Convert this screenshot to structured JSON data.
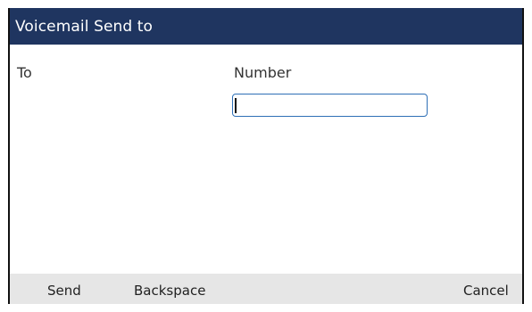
{
  "header": {
    "title": "Voicemail Send to"
  },
  "form": {
    "to_label": "To",
    "number_label": "Number",
    "number_value": ""
  },
  "softkeys": {
    "send": "Send",
    "backspace": "Backspace",
    "cancel": "Cancel"
  },
  "colors": {
    "title_bar": "#1f3560",
    "field_border": "#2e6fb6",
    "softkey_bar": "#e6e6e6"
  }
}
